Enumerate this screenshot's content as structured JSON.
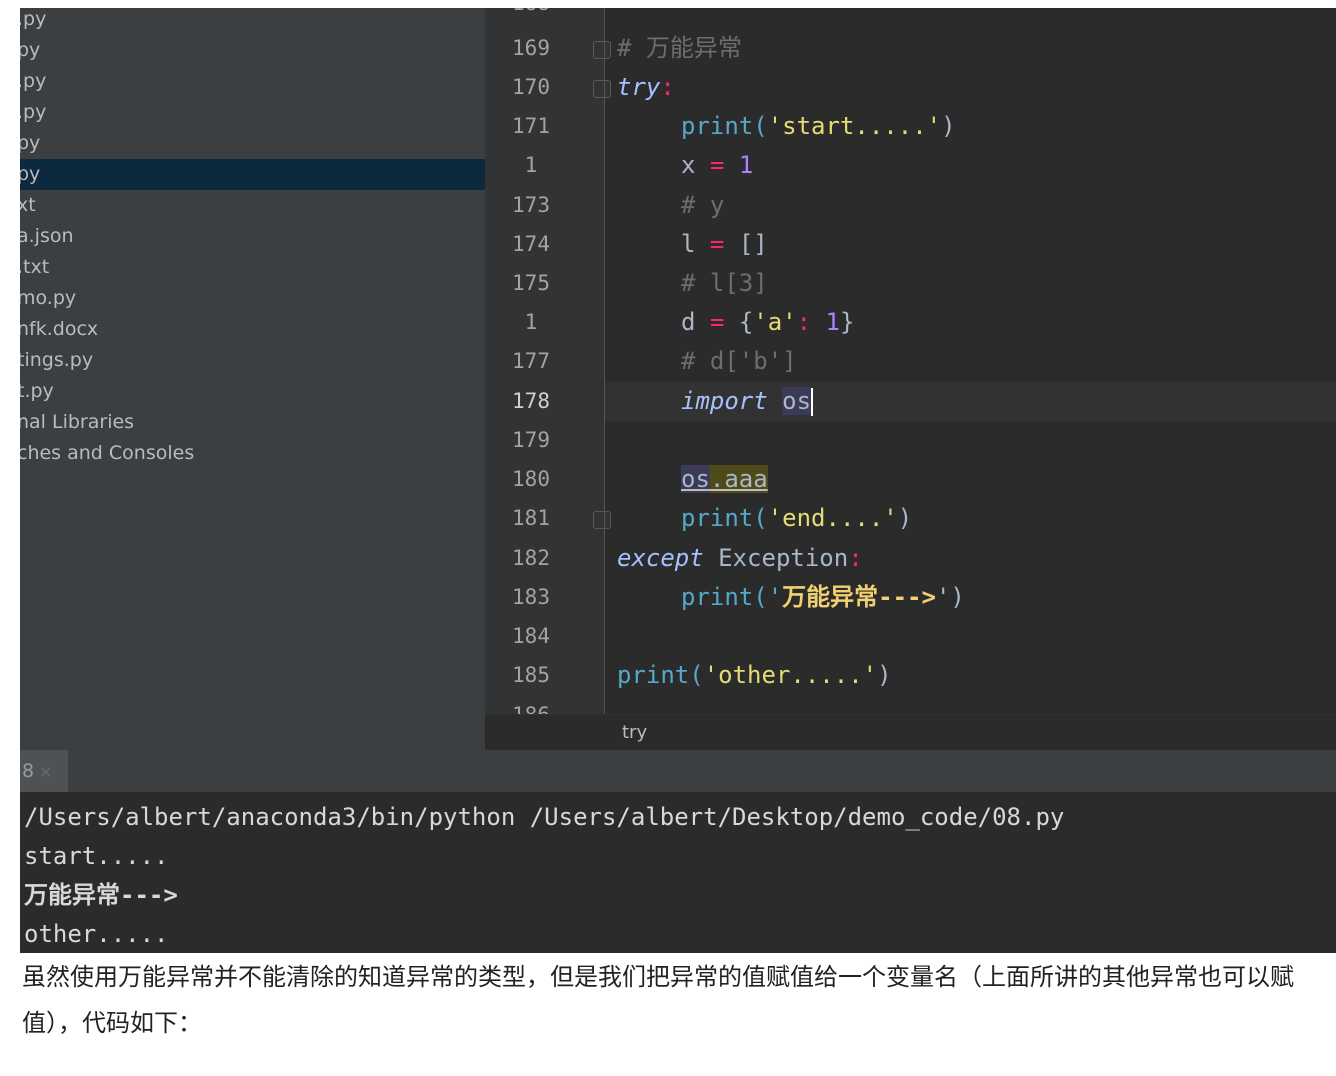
{
  "sidebar": {
    "items": [
      {
        "label": ".py"
      },
      {
        "label": "py"
      },
      {
        "label": ".py"
      },
      {
        "label": ".py"
      },
      {
        "label": "py"
      },
      {
        "label": "py",
        "selected": true
      },
      {
        "label": "xt"
      },
      {
        "label": "a.json"
      },
      {
        "label": ".txt"
      },
      {
        "label": "mo.py"
      },
      {
        "label": "nfk.docx"
      },
      {
        "label": "tings.py"
      },
      {
        "label": "t.py"
      },
      {
        "label": "nal Libraries"
      },
      {
        "label": "ches and Consoles"
      }
    ]
  },
  "editor": {
    "top_partial_line": "168",
    "bottom_partial_line": "186",
    "current_line": "178",
    "lines": [
      {
        "num": "169",
        "comment": "# 万能异常"
      },
      {
        "num": "170",
        "kw": "try",
        "punct": ":"
      },
      {
        "num": "171",
        "fn": "print",
        "open": "(",
        "str": "'start.....'",
        "close": ")"
      },
      {
        "num": "1",
        "var": "x",
        "op": "="
      },
      {
        "num": "173",
        "comment": "# y"
      },
      {
        "num": "174",
        "var": "l",
        "op": "=",
        "rest": "[]"
      },
      {
        "num": "175",
        "comment": "# l[3]"
      },
      {
        "num": "1",
        "var": "d",
        "op": "=",
        "open": "{",
        "str": "'a'",
        "colon": ":",
        "close": "}"
      },
      {
        "num": "177",
        "comment": "# d['b']"
      },
      {
        "num": "178",
        "kw": "import",
        "mod": "os"
      },
      {
        "num": "179"
      },
      {
        "num": "180",
        "mod": "os",
        "attr": ".aaa"
      },
      {
        "num": "181",
        "fn": "print",
        "open": "(",
        "str": "'end....'",
        "close": ")"
      },
      {
        "num": "182",
        "kw": "except",
        "cls": "Exception",
        "punct": ":"
      },
      {
        "num": "183",
        "fn": "print",
        "open": "('",
        "str": "万能异常--->",
        "close": "')"
      },
      {
        "num": "184"
      },
      {
        "num": "185",
        "fn": "print",
        "open": "(",
        "str": "'other.....'",
        "close": ")"
      }
    ],
    "breadcrumb": "try"
  },
  "run": {
    "tab_label": "8",
    "tab_close": "×",
    "output": [
      "/Users/albert/anaconda3/bin/python /Users/albert/Desktop/demo_code/08.py",
      "start.....",
      "万能异常--->",
      "other....."
    ]
  },
  "article": {
    "paragraph": "虽然使用万能异常并不能清除的知道异常的类型，但是我们把异常的值赋值给一个变量名（上面所讲的其他异常也可以赋值），代码如下："
  }
}
